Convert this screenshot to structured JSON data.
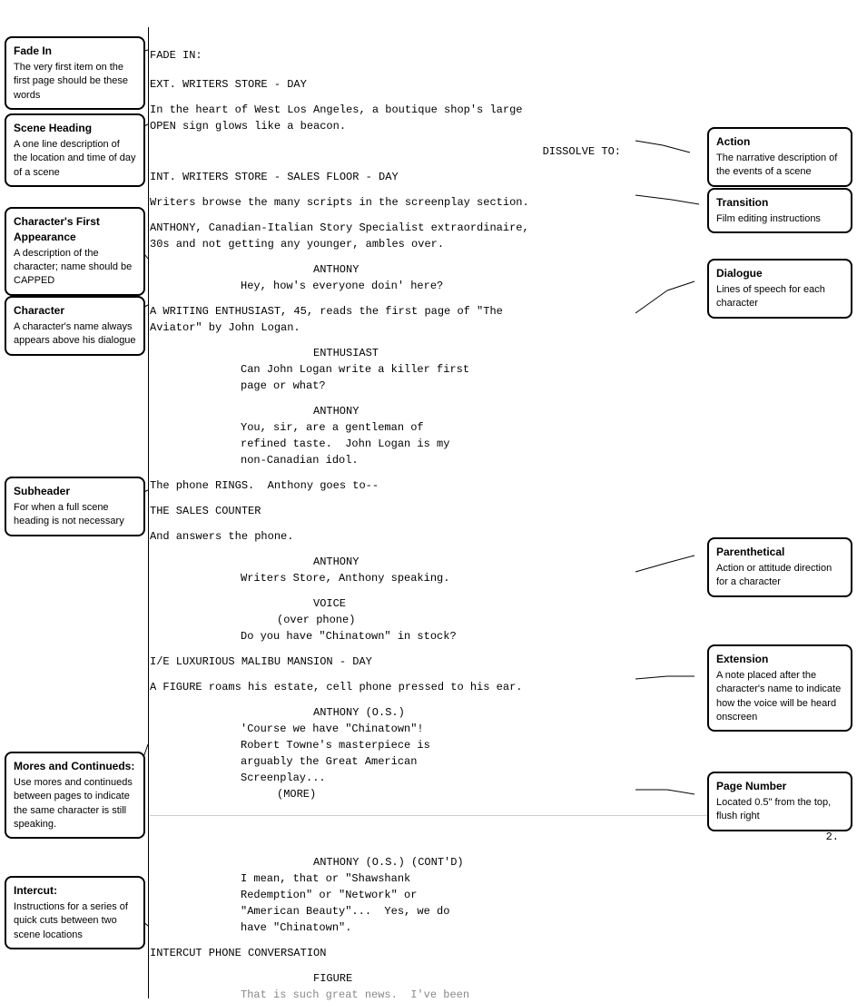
{
  "annotations": {
    "fade_in": {
      "title": "Fade In",
      "description": "The very first item on the first page should be these words"
    },
    "scene_heading": {
      "title": "Scene Heading",
      "description": "A one line description of the location and time of day of a scene"
    },
    "character_first": {
      "title": "Character's First Appearance",
      "description": "A description of the character; name should be CAPPED"
    },
    "character": {
      "title": "Character",
      "description": "A character's name always appears above his dialogue"
    },
    "subheader": {
      "title": "Subheader",
      "description": "For when a full scene heading is not necessary"
    },
    "mores": {
      "title": "Mores and Continueds:",
      "description": "Use mores and continueds between pages to indicate the same character is still speaking."
    },
    "intercut": {
      "title": "Intercut:",
      "description": "Instructions for a series of quick cuts between two scene locations"
    },
    "action": {
      "title": "Action",
      "description": "The narrative description of the events of a scene"
    },
    "transition": {
      "title": "Transition",
      "description": "Film editing instructions"
    },
    "dialogue": {
      "title": "Dialogue",
      "description": "Lines of speech for each character"
    },
    "parenthetical": {
      "title": "Parenthetical",
      "description": "Action or attitude direction for a character"
    },
    "extension": {
      "title": "Extension",
      "description": "A note placed after the character's name to indicate how the voice will be heard onscreen"
    },
    "page_number": {
      "title": "Page Number",
      "description": "Located 0.5\" from the top, flush right"
    }
  },
  "screenplay": {
    "lines": [
      {
        "text": "FADE IN:",
        "indent": 0
      },
      {
        "text": "",
        "indent": 0
      },
      {
        "text": "EXT. WRITERS STORE - DAY",
        "indent": 0
      },
      {
        "text": "",
        "indent": 0
      },
      {
        "text": "In the heart of West Los Angeles, a boutique shop's large",
        "indent": 0
      },
      {
        "text": "OPEN sign glows like a beacon.",
        "indent": 0
      },
      {
        "text": "",
        "indent": 0
      },
      {
        "text": "                                              DISSOLVE TO:",
        "indent": 0
      },
      {
        "text": "",
        "indent": 0
      },
      {
        "text": "INT. WRITERS STORE - SALES FLOOR - DAY",
        "indent": 0
      },
      {
        "text": "",
        "indent": 0
      },
      {
        "text": "Writers browse the many scripts in the screenplay section.",
        "indent": 0
      },
      {
        "text": "",
        "indent": 0
      },
      {
        "text": "ANTHONY, Canadian-Italian Story Specialist extraordinaire,",
        "indent": 0
      },
      {
        "text": "30s and not getting any younger, ambles over.",
        "indent": 0
      },
      {
        "text": "",
        "indent": 0
      },
      {
        "text": "                    ANTHONY",
        "indent": 0
      },
      {
        "text": "          Hey, how's everyone doin' here?",
        "indent": 0
      },
      {
        "text": "",
        "indent": 0
      },
      {
        "text": "A WRITING ENTHUSIAST, 45, reads the first page of \"The",
        "indent": 0
      },
      {
        "text": "Aviator\" by John Logan.",
        "indent": 0
      },
      {
        "text": "",
        "indent": 0
      },
      {
        "text": "                    ENTHUSIAST",
        "indent": 0
      },
      {
        "text": "          Can John Logan write a killer first",
        "indent": 0
      },
      {
        "text": "          page or what?",
        "indent": 0
      },
      {
        "text": "",
        "indent": 0
      },
      {
        "text": "                    ANTHONY",
        "indent": 0
      },
      {
        "text": "          You, sir, are a gentleman of",
        "indent": 0
      },
      {
        "text": "          refined taste.  John Logan is my",
        "indent": 0
      },
      {
        "text": "          non-Canadian idol.",
        "indent": 0
      },
      {
        "text": "",
        "indent": 0
      },
      {
        "text": "The phone RINGS.  Anthony goes to--",
        "indent": 0
      },
      {
        "text": "",
        "indent": 0
      },
      {
        "text": "THE SALES COUNTER",
        "indent": 0
      },
      {
        "text": "",
        "indent": 0
      },
      {
        "text": "And answers the phone.",
        "indent": 0
      },
      {
        "text": "",
        "indent": 0
      },
      {
        "text": "                    ANTHONY",
        "indent": 0
      },
      {
        "text": "          Writers Store, Anthony speaking.",
        "indent": 0
      },
      {
        "text": "",
        "indent": 0
      },
      {
        "text": "                    VOICE",
        "indent": 0
      },
      {
        "text": "               (over phone)",
        "indent": 0
      },
      {
        "text": "          Do you have \"Chinatown\" in stock?",
        "indent": 0
      },
      {
        "text": "",
        "indent": 0
      },
      {
        "text": "I/E LUXURIOUS MALIBU MANSION - DAY",
        "indent": 0
      },
      {
        "text": "",
        "indent": 0
      },
      {
        "text": "A FIGURE roams his estate, cell phone pressed to his ear.",
        "indent": 0
      },
      {
        "text": "",
        "indent": 0
      },
      {
        "text": "                    ANTHONY (O.S.)",
        "indent": 0
      },
      {
        "text": "          'Course we have \"Chinatown\"!",
        "indent": 0
      },
      {
        "text": "          Robert Towne's masterpiece is",
        "indent": 0
      },
      {
        "text": "          arguably the Great American",
        "indent": 0
      },
      {
        "text": "          Screenplay...",
        "indent": 0
      },
      {
        "text": "               (MORE)",
        "indent": 0
      },
      {
        "text": "",
        "indent": 0
      },
      {
        "text": "                                                        2.",
        "indent": 0,
        "page_number": true
      },
      {
        "text": "",
        "indent": 0
      },
      {
        "text": "                    ANTHONY (O.S.) (CONT'D)",
        "indent": 0
      },
      {
        "text": "          I mean, that or \"Shawshank",
        "indent": 0
      },
      {
        "text": "          Redemption\" or \"Network\" or",
        "indent": 0
      },
      {
        "text": "          \"American Beauty\"...  Yes, we do",
        "indent": 0
      },
      {
        "text": "          have \"Chinatown\".",
        "indent": 0
      },
      {
        "text": "",
        "indent": 0
      },
      {
        "text": "INTERCUT PHONE CONVERSATION",
        "indent": 0
      },
      {
        "text": "",
        "indent": 0
      },
      {
        "text": "                    FIGURE",
        "indent": 0
      },
      {
        "text": "          That is such great news.  I've been",
        "indent": 0
      }
    ]
  }
}
